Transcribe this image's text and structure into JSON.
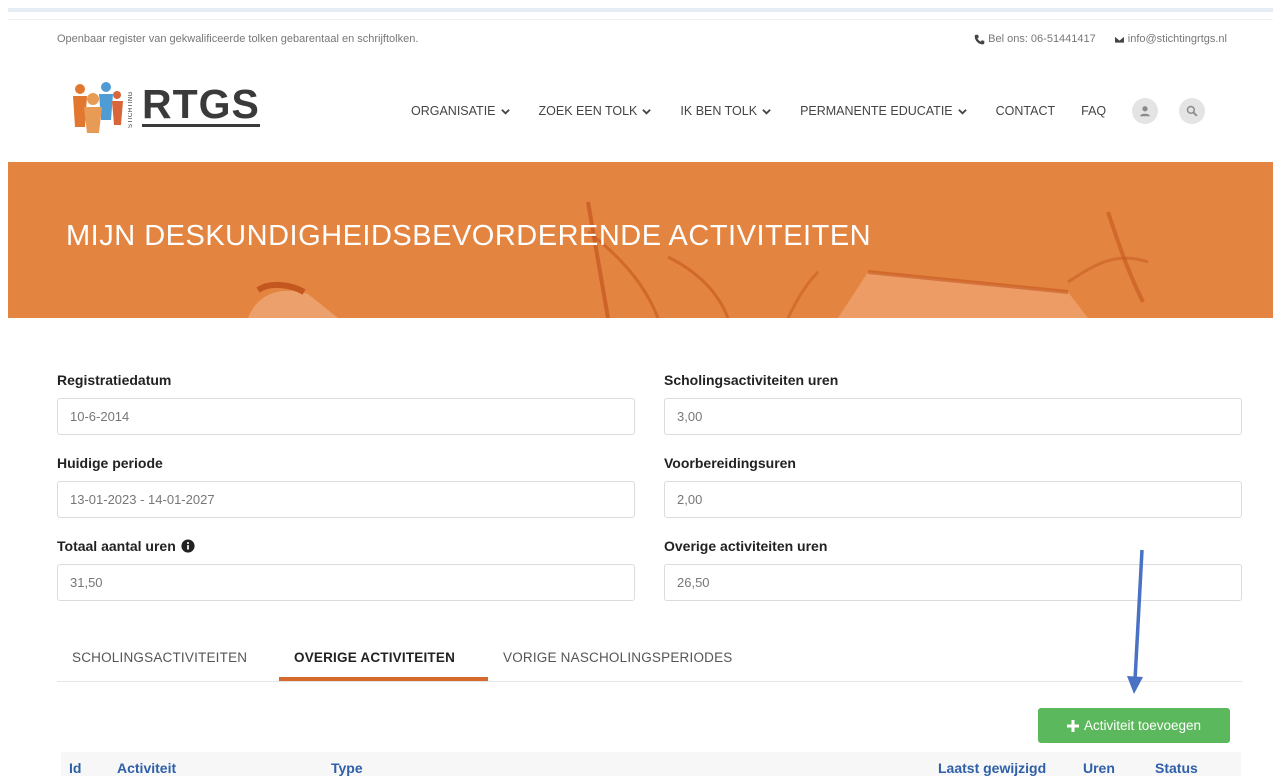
{
  "topbar": {
    "tagline": "Openbaar register van gekwalificeerde tolken gebarentaal en schrijftolken.",
    "phone": "Bel ons: 06-51441417",
    "email": "info@stichtingrtgs.nl"
  },
  "logo": {
    "small_text": "STICHTING",
    "word": "RTGS"
  },
  "nav": {
    "items": [
      {
        "label": "ORGANISATIE"
      },
      {
        "label": "ZOEK EEN TOLK"
      },
      {
        "label": "IK BEN TOLK"
      },
      {
        "label": "PERMANENTE EDUCATIE"
      },
      {
        "label": "CONTACT"
      },
      {
        "label": "FAQ"
      }
    ]
  },
  "hero": {
    "title": "MIJN DESKUNDIGHEIDSBEVORDERENDE ACTIVITEITEN"
  },
  "fields": {
    "registratiedatum": {
      "label": "Registratiedatum",
      "value": "10-6-2014"
    },
    "huidige_periode": {
      "label": "Huidige periode",
      "value": "13-01-2023 - 14-01-2027"
    },
    "totaal_uren": {
      "label": "Totaal aantal uren",
      "value": "31,50"
    },
    "scholing_uren": {
      "label": "Scholingsactiviteiten uren",
      "value": "3,00"
    },
    "voorbereiding_uren": {
      "label": "Voorbereidingsuren",
      "value": "2,00"
    },
    "overige_uren": {
      "label": "Overige activiteiten uren",
      "value": "26,50"
    }
  },
  "tabs": [
    {
      "label": "SCHOLINGSACTIVITEITEN"
    },
    {
      "label": "OVERIGE ACTIVITEITEN"
    },
    {
      "label": "VORIGE NASCHOLINGSPERIODES"
    }
  ],
  "add_button": {
    "label": "Activiteit toevoegen"
  },
  "table": {
    "columns": [
      "Id",
      "Activiteit",
      "Type",
      "Laatst gewijzigd",
      "Uren",
      "Status"
    ]
  },
  "colors": {
    "hero": "#e38440",
    "tab_active": "#d66a2c",
    "button": "#5cb85c",
    "table_header": "#2e5fa8",
    "arrow": "#4a72c4"
  }
}
